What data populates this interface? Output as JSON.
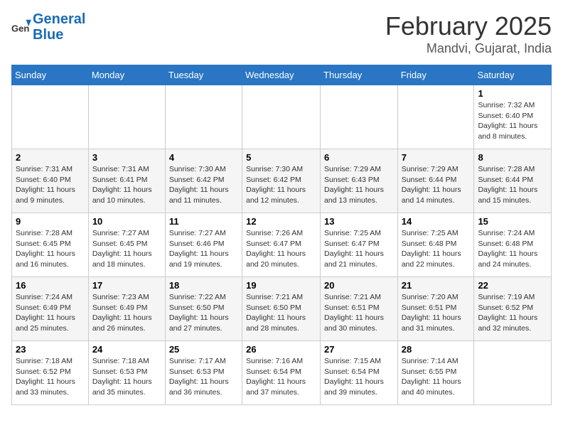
{
  "logo": {
    "line1": "General",
    "line2": "Blue"
  },
  "title": "February 2025",
  "location": "Mandvi, Gujarat, India",
  "weekdays": [
    "Sunday",
    "Monday",
    "Tuesday",
    "Wednesday",
    "Thursday",
    "Friday",
    "Saturday"
  ],
  "weeks": [
    [
      {
        "day": "",
        "info": ""
      },
      {
        "day": "",
        "info": ""
      },
      {
        "day": "",
        "info": ""
      },
      {
        "day": "",
        "info": ""
      },
      {
        "day": "",
        "info": ""
      },
      {
        "day": "",
        "info": ""
      },
      {
        "day": "1",
        "info": "Sunrise: 7:32 AM\nSunset: 6:40 PM\nDaylight: 11 hours and 8 minutes."
      }
    ],
    [
      {
        "day": "2",
        "info": "Sunrise: 7:31 AM\nSunset: 6:40 PM\nDaylight: 11 hours and 9 minutes."
      },
      {
        "day": "3",
        "info": "Sunrise: 7:31 AM\nSunset: 6:41 PM\nDaylight: 11 hours and 10 minutes."
      },
      {
        "day": "4",
        "info": "Sunrise: 7:30 AM\nSunset: 6:42 PM\nDaylight: 11 hours and 11 minutes."
      },
      {
        "day": "5",
        "info": "Sunrise: 7:30 AM\nSunset: 6:42 PM\nDaylight: 11 hours and 12 minutes."
      },
      {
        "day": "6",
        "info": "Sunrise: 7:29 AM\nSunset: 6:43 PM\nDaylight: 11 hours and 13 minutes."
      },
      {
        "day": "7",
        "info": "Sunrise: 7:29 AM\nSunset: 6:44 PM\nDaylight: 11 hours and 14 minutes."
      },
      {
        "day": "8",
        "info": "Sunrise: 7:28 AM\nSunset: 6:44 PM\nDaylight: 11 hours and 15 minutes."
      }
    ],
    [
      {
        "day": "9",
        "info": "Sunrise: 7:28 AM\nSunset: 6:45 PM\nDaylight: 11 hours and 16 minutes."
      },
      {
        "day": "10",
        "info": "Sunrise: 7:27 AM\nSunset: 6:45 PM\nDaylight: 11 hours and 18 minutes."
      },
      {
        "day": "11",
        "info": "Sunrise: 7:27 AM\nSunset: 6:46 PM\nDaylight: 11 hours and 19 minutes."
      },
      {
        "day": "12",
        "info": "Sunrise: 7:26 AM\nSunset: 6:47 PM\nDaylight: 11 hours and 20 minutes."
      },
      {
        "day": "13",
        "info": "Sunrise: 7:25 AM\nSunset: 6:47 PM\nDaylight: 11 hours and 21 minutes."
      },
      {
        "day": "14",
        "info": "Sunrise: 7:25 AM\nSunset: 6:48 PM\nDaylight: 11 hours and 22 minutes."
      },
      {
        "day": "15",
        "info": "Sunrise: 7:24 AM\nSunset: 6:48 PM\nDaylight: 11 hours and 24 minutes."
      }
    ],
    [
      {
        "day": "16",
        "info": "Sunrise: 7:24 AM\nSunset: 6:49 PM\nDaylight: 11 hours and 25 minutes."
      },
      {
        "day": "17",
        "info": "Sunrise: 7:23 AM\nSunset: 6:49 PM\nDaylight: 11 hours and 26 minutes."
      },
      {
        "day": "18",
        "info": "Sunrise: 7:22 AM\nSunset: 6:50 PM\nDaylight: 11 hours and 27 minutes."
      },
      {
        "day": "19",
        "info": "Sunrise: 7:21 AM\nSunset: 6:50 PM\nDaylight: 11 hours and 28 minutes."
      },
      {
        "day": "20",
        "info": "Sunrise: 7:21 AM\nSunset: 6:51 PM\nDaylight: 11 hours and 30 minutes."
      },
      {
        "day": "21",
        "info": "Sunrise: 7:20 AM\nSunset: 6:51 PM\nDaylight: 11 hours and 31 minutes."
      },
      {
        "day": "22",
        "info": "Sunrise: 7:19 AM\nSunset: 6:52 PM\nDaylight: 11 hours and 32 minutes."
      }
    ],
    [
      {
        "day": "23",
        "info": "Sunrise: 7:18 AM\nSunset: 6:52 PM\nDaylight: 11 hours and 33 minutes."
      },
      {
        "day": "24",
        "info": "Sunrise: 7:18 AM\nSunset: 6:53 PM\nDaylight: 11 hours and 35 minutes."
      },
      {
        "day": "25",
        "info": "Sunrise: 7:17 AM\nSunset: 6:53 PM\nDaylight: 11 hours and 36 minutes."
      },
      {
        "day": "26",
        "info": "Sunrise: 7:16 AM\nSunset: 6:54 PM\nDaylight: 11 hours and 37 minutes."
      },
      {
        "day": "27",
        "info": "Sunrise: 7:15 AM\nSunset: 6:54 PM\nDaylight: 11 hours and 39 minutes."
      },
      {
        "day": "28",
        "info": "Sunrise: 7:14 AM\nSunset: 6:55 PM\nDaylight: 11 hours and 40 minutes."
      },
      {
        "day": "",
        "info": ""
      }
    ]
  ]
}
